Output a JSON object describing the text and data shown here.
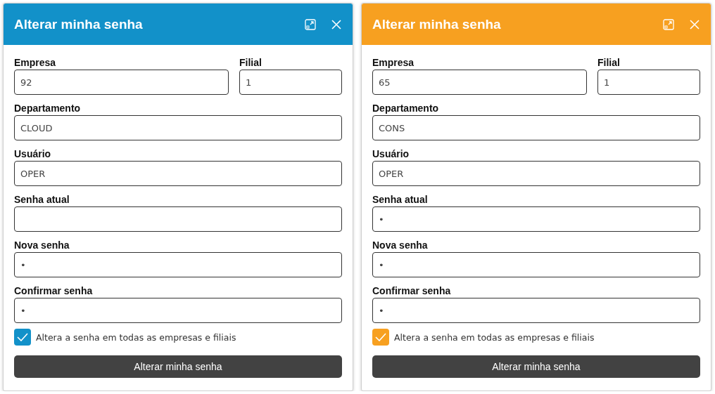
{
  "dialogs": [
    {
      "title": "Alterar minha senha",
      "color": "#1291c9",
      "rows": [
        [
          {
            "label": "Empresa",
            "value": "92"
          },
          {
            "label": "Filial",
            "value": "1"
          }
        ],
        [
          {
            "label": "Departamento",
            "value": "CLOUD"
          }
        ],
        [
          {
            "label": "Usuário",
            "value": "OPER"
          }
        ],
        [
          {
            "label": "Senha atual"
          }
        ],
        [
          {
            "label": "Nova senha",
            "value": "•"
          }
        ],
        [
          {
            "label": "Confirmar senha",
            "value": "•"
          }
        ]
      ],
      "checkbox": {
        "label": "Altera a senha em todas as empresas e filiais",
        "checked": true
      },
      "button": "Alterar minha senha"
    },
    {
      "title": "Alterar minha senha",
      "color": "#f7a020",
      "rows": [
        [
          {
            "label": "Empresa",
            "value": "65"
          },
          {
            "label": "Filial",
            "value": "1"
          }
        ],
        [
          {
            "label": "Departamento",
            "value": "CONS"
          }
        ],
        [
          {
            "label": "Usuário",
            "value": "OPER"
          }
        ],
        [
          {
            "label": "Senha atual",
            "value": "•"
          }
        ],
        [
          {
            "label": "Nova senha",
            "value": "•"
          }
        ],
        [
          {
            "label": "Confirmar senha",
            "value": "•"
          }
        ]
      ],
      "checkbox": {
        "label": "Altera a senha em todas as empresas e filiais",
        "checked": true
      },
      "button": "Alterar minha senha"
    }
  ]
}
